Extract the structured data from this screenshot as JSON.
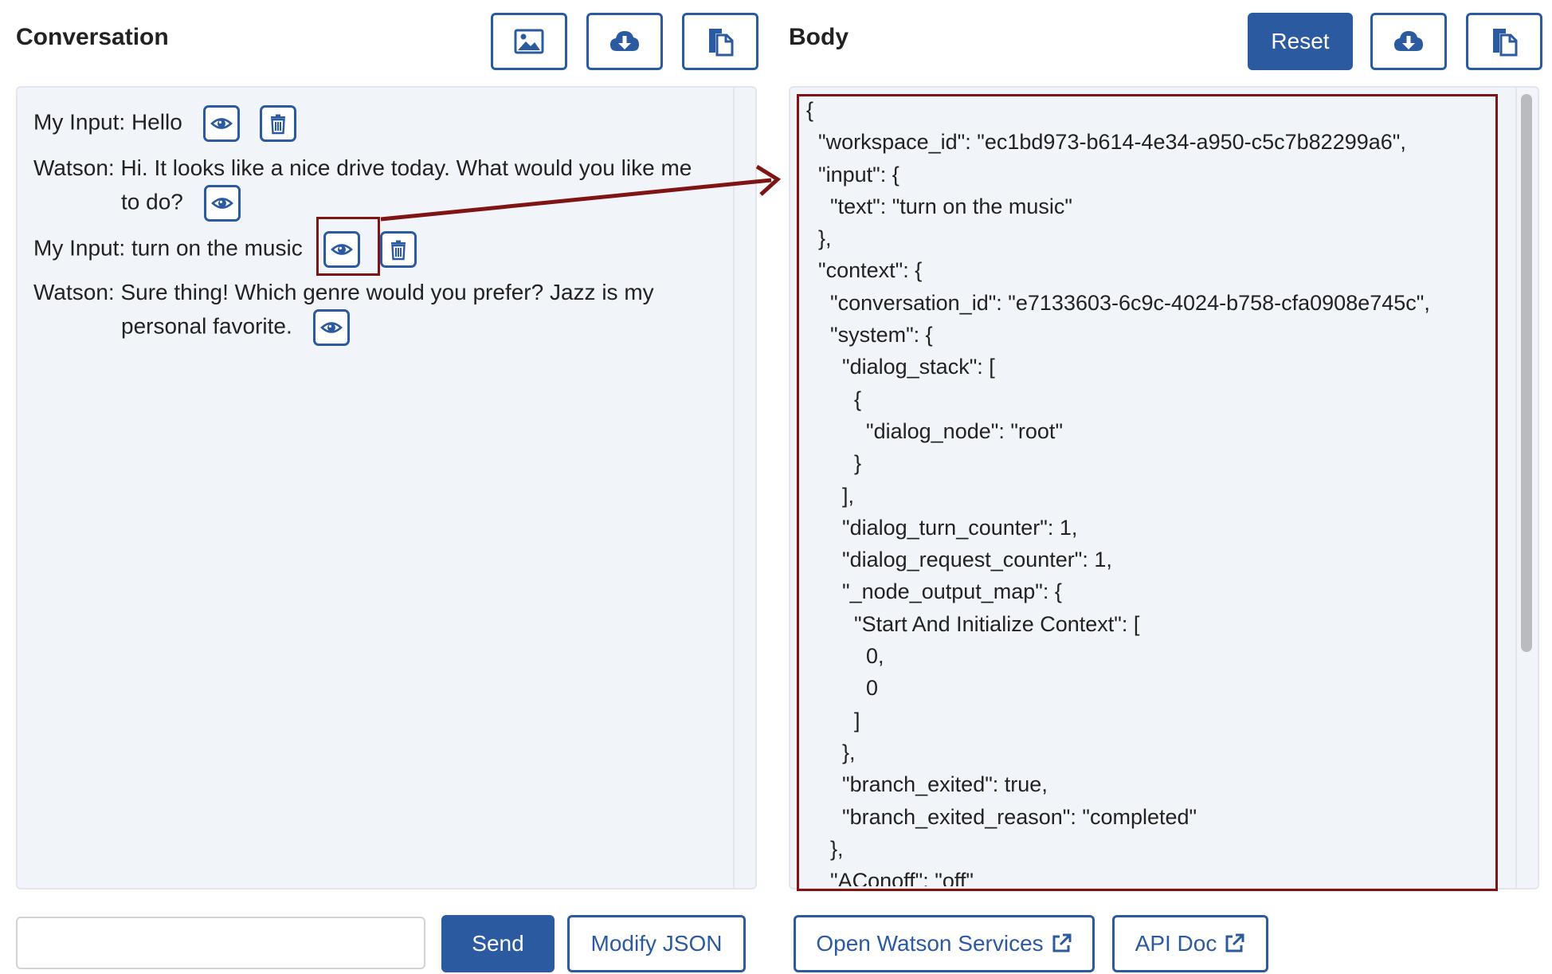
{
  "conversation": {
    "title": "Conversation",
    "messages": [
      {
        "who": "My Input:",
        "text": "Hello"
      },
      {
        "who": "Watson:",
        "text": "Hi. It looks like a nice drive today. What would you like me",
        "cont": "to do?"
      },
      {
        "who": "My Input:",
        "text": "turn on the music"
      },
      {
        "who": "Watson:",
        "text": "Sure thing! Which genre would you prefer? Jazz is my",
        "cont": "personal favorite."
      }
    ],
    "input_value": "",
    "send_label": "Send",
    "modify_label": "Modify JSON"
  },
  "body": {
    "title": "Body",
    "reset_label": "Reset",
    "json_lines": [
      "{",
      "  \"workspace_id\": \"ec1bd973-b614-4e34-a950-c5c7b82299a6\",",
      "  \"input\": {",
      "    \"text\": \"turn on the music\"",
      "  },",
      "  \"context\": {",
      "    \"conversation_id\": \"e7133603-6c9c-4024-b758-cfa0908e745c\",",
      "    \"system\": {",
      "      \"dialog_stack\": [",
      "        {",
      "          \"dialog_node\": \"root\"",
      "        }",
      "      ],",
      "      \"dialog_turn_counter\": 1,",
      "      \"dialog_request_counter\": 1,",
      "      \"_node_output_map\": {",
      "        \"Start And Initialize Context\": [",
      "          0,",
      "          0",
      "        ]",
      "      },",
      "      \"branch_exited\": true,",
      "      \"branch_exited_reason\": \"completed\"",
      "    },",
      "    \"AConoff\": \"off\""
    ],
    "open_watson_label": "Open Watson Services",
    "api_doc_label": "API Doc"
  },
  "colors": {
    "accent": "#2c5aa0",
    "highlight": "#7f1414",
    "panel_bg": "#f1f4f8"
  },
  "icons": [
    "image-icon",
    "cloud-download-icon",
    "copy-icon",
    "eye-icon",
    "trash-icon",
    "external-link-icon"
  ]
}
